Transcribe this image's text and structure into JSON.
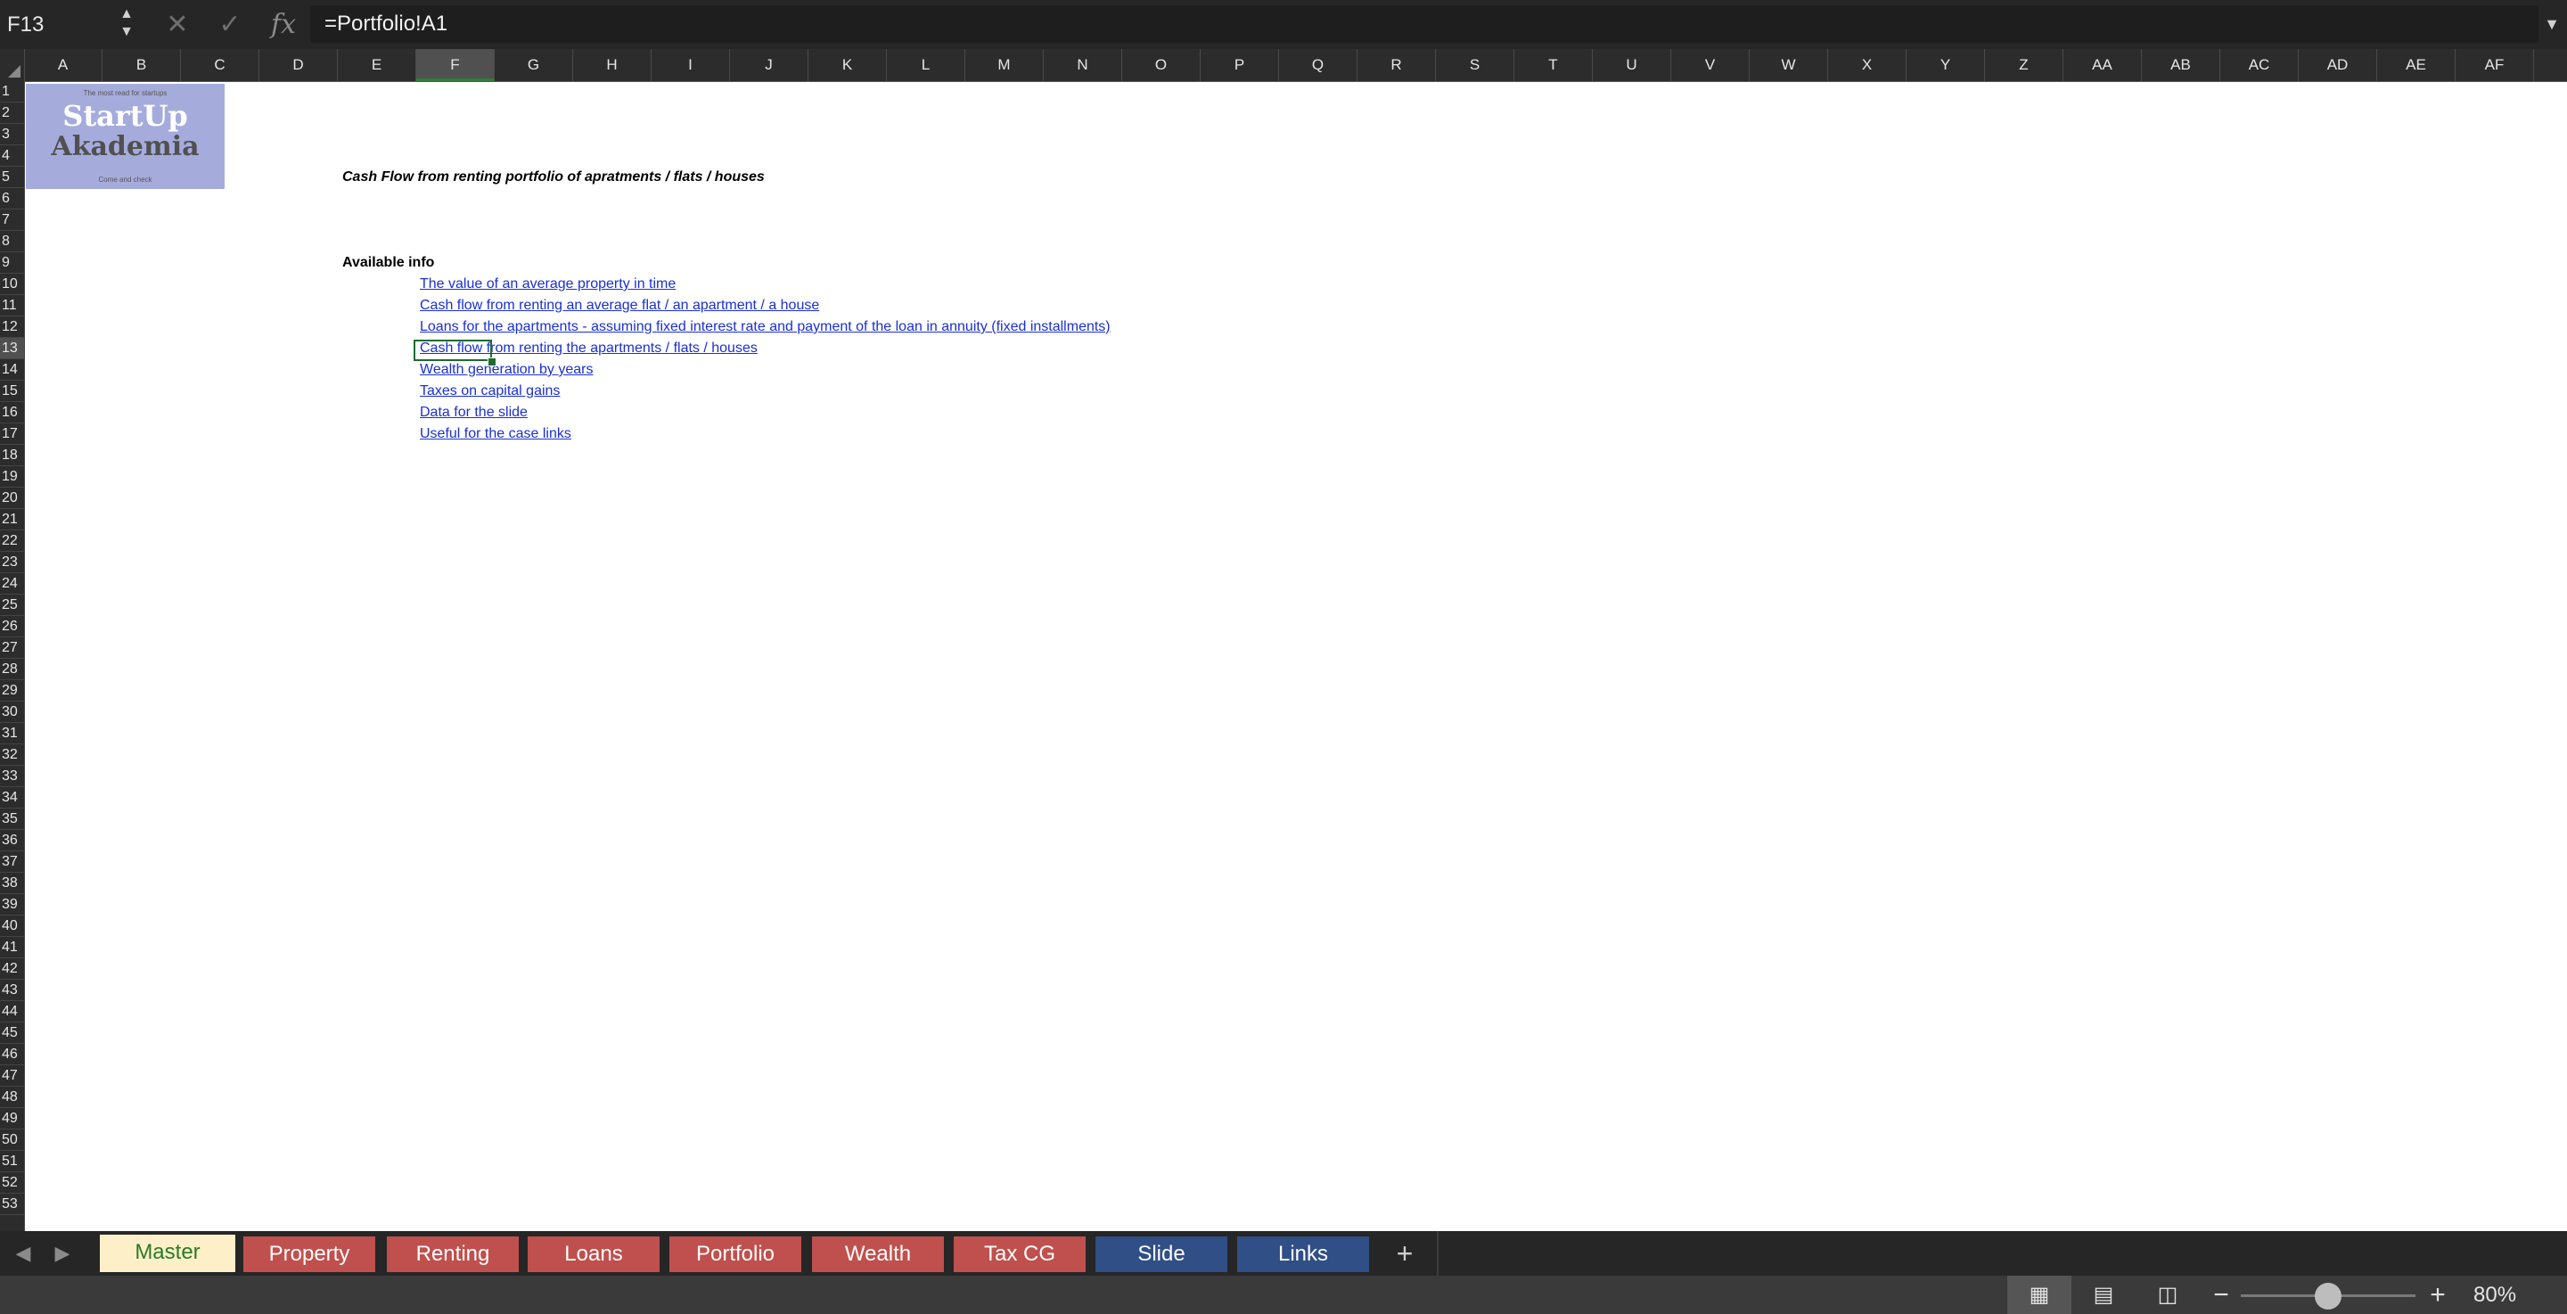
{
  "formula_bar": {
    "name_box": "F13",
    "cancel_icon": "cancel-icon",
    "confirm_icon": "confirm-icon",
    "fx_label": "fx",
    "formula": "=Portfolio!A1"
  },
  "columns": [
    "A",
    "B",
    "C",
    "D",
    "E",
    "F",
    "G",
    "H",
    "I",
    "J",
    "K",
    "L",
    "M",
    "N",
    "O",
    "P",
    "Q",
    "R",
    "S",
    "T",
    "U",
    "V",
    "W",
    "X",
    "Y",
    "Z",
    "AA",
    "AB",
    "AC",
    "AD",
    "AE",
    "AF"
  ],
  "active_column": "F",
  "rows": [
    "1",
    "2",
    "3",
    "4",
    "5",
    "6",
    "7",
    "8",
    "9",
    "10",
    "11",
    "12",
    "13",
    "14",
    "15",
    "16",
    "17",
    "18",
    "19",
    "20",
    "21",
    "22",
    "23",
    "24",
    "25",
    "26",
    "27",
    "28",
    "29",
    "30",
    "31",
    "32",
    "33",
    "34",
    "35",
    "36",
    "37",
    "38",
    "39",
    "40",
    "41",
    "42",
    "43",
    "44",
    "45",
    "46",
    "47",
    "48",
    "49",
    "50",
    "51",
    "52",
    "53"
  ],
  "active_row": "13",
  "logo": {
    "tagline": "The most read for startups",
    "title": "StartUp",
    "subtitle": "Akademia",
    "footer": "Come and check"
  },
  "sheet": {
    "title": "Cash Flow from renting portfolio of apratments / flats / houses",
    "available_label": "Available info",
    "links": [
      "The value of an average property in time",
      "Cash flow from renting an average flat / an apartment / a house",
      "Loans for the apartments - assuming fixed interest rate and payment of the loan in annuity (fixed installments)",
      "Cash flow from renting the apartments / flats / houses",
      "Wealth generation by years",
      "Taxes on capital gains",
      "Data for the slide",
      "Useful for the case links"
    ]
  },
  "tabs": [
    {
      "label": "Master",
      "color": "#fdf0c8",
      "active": true
    },
    {
      "label": "Property",
      "color": "#c0504d"
    },
    {
      "label": "Renting",
      "color": "#c0504d"
    },
    {
      "label": "Loans",
      "color": "#c0504d"
    },
    {
      "label": "Portfolio",
      "color": "#c0504d"
    },
    {
      "label": "Wealth",
      "color": "#c0504d"
    },
    {
      "label": "Tax CG",
      "color": "#c0504d"
    },
    {
      "label": "Slide",
      "color": "#2f4f86"
    },
    {
      "label": "Links",
      "color": "#2f4f86"
    }
  ],
  "status": {
    "zoom": "80%",
    "zoom_fraction": 0.5
  }
}
